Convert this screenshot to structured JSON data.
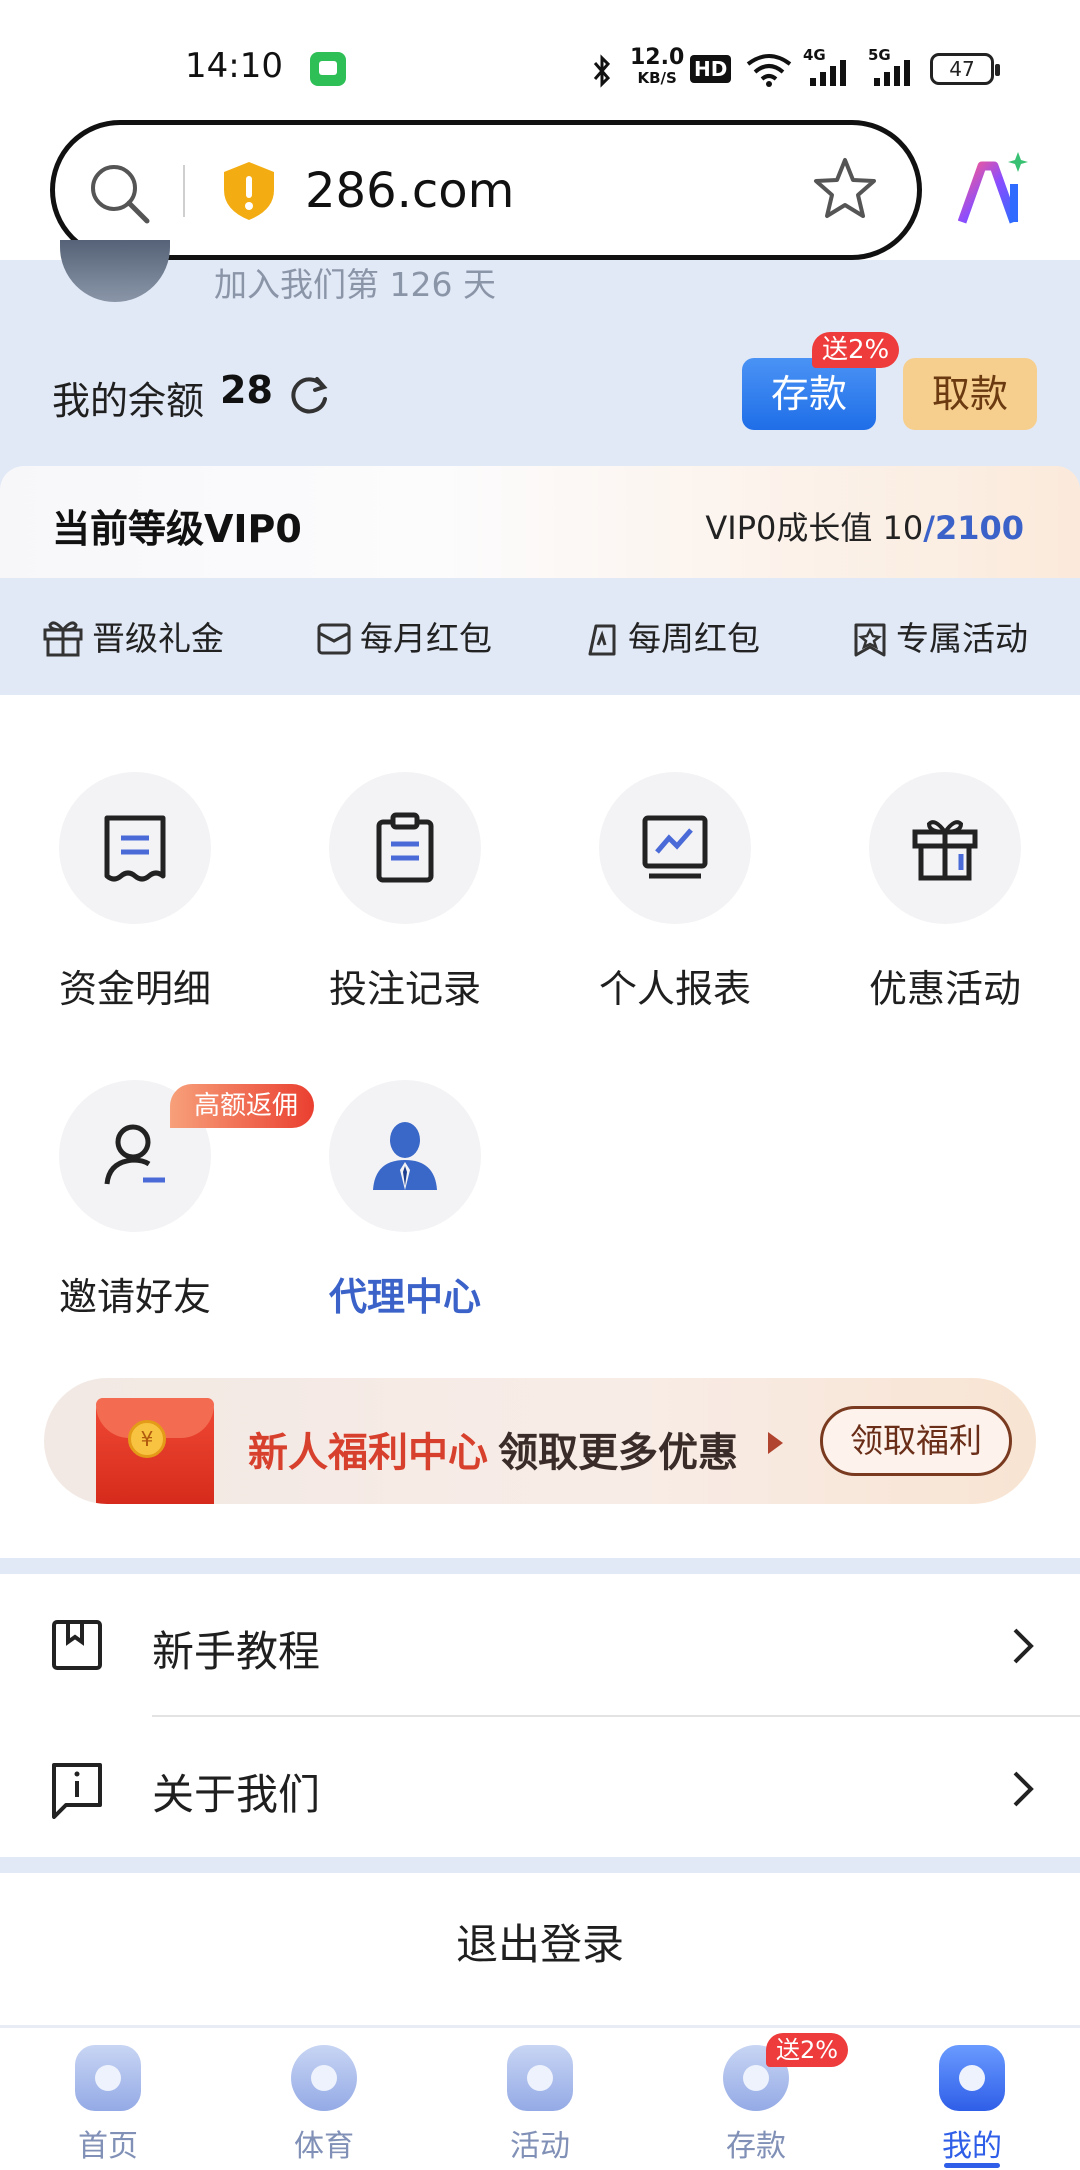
{
  "status_bar": {
    "time": "14:10",
    "speed": "12.0",
    "speed_unit": "KB/S",
    "hd": "HD",
    "net1": "4G",
    "net2": "5G",
    "battery": "47"
  },
  "browser": {
    "url": "286.com"
  },
  "profile": {
    "join_text": "加入我们第 126 天"
  },
  "balance": {
    "label": "我的余额",
    "value": "28"
  },
  "actions": {
    "deposit": "存款",
    "deposit_badge": "送2%",
    "withdraw": "取款"
  },
  "vip": {
    "level": "当前等级VIP0",
    "growth_label": "VIP0成长值",
    "growth_current": "10",
    "growth_sep": "/",
    "growth_max": "2100"
  },
  "benefits": [
    {
      "label": "晋级礼金",
      "icon": "gift-icon"
    },
    {
      "label": "每月红包",
      "icon": "envelope-icon"
    },
    {
      "label": "每周红包",
      "icon": "calendar-icon"
    },
    {
      "label": "专属活动",
      "icon": "star-badge-icon"
    }
  ],
  "grid": [
    {
      "label": "资金明细",
      "icon": "receipt-icon"
    },
    {
      "label": "投注记录",
      "icon": "clipboard-icon"
    },
    {
      "label": "个人报表",
      "icon": "chart-monitor-icon"
    },
    {
      "label": "优惠活动",
      "icon": "gift-box-icon"
    },
    {
      "label": "邀请好友",
      "icon": "add-user-icon",
      "badge": "高额返佣"
    },
    {
      "label": "代理中心",
      "icon": "agent-icon"
    }
  ],
  "banner": {
    "coin": "¥",
    "title_red": "新人福利中心",
    "title_dark": "领取更多优惠",
    "button": "领取福利"
  },
  "menu": [
    {
      "label": "新手教程",
      "icon": "book-icon"
    },
    {
      "label": "关于我们",
      "icon": "info-icon"
    }
  ],
  "logout": "退出登录",
  "bottom_nav": [
    {
      "label": "首页"
    },
    {
      "label": "体育"
    },
    {
      "label": "活动"
    },
    {
      "label": "存款",
      "badge": "送2%"
    },
    {
      "label": "我的"
    }
  ],
  "colors": {
    "accent": "#2f5ee8",
    "page_bg": "#e1e9f6",
    "badge_red": "#ee3b3b"
  }
}
